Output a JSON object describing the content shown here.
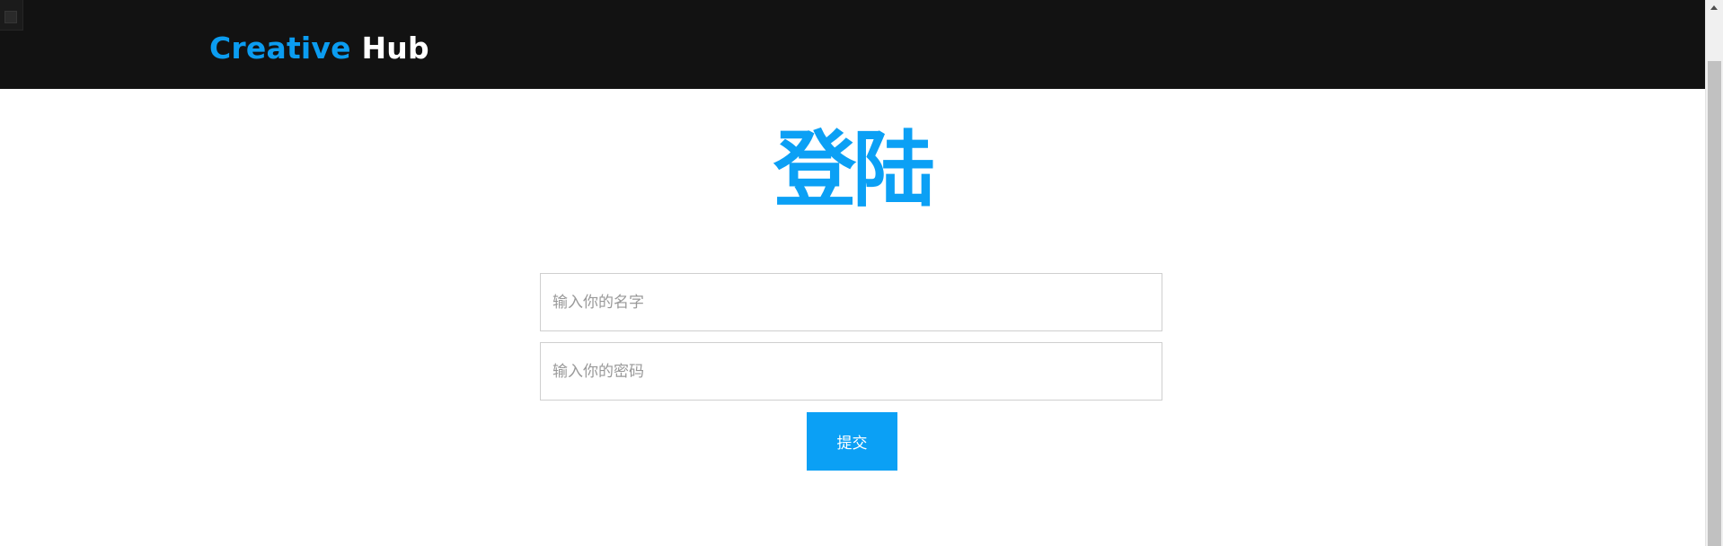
{
  "header": {
    "brand_primary": "Creative",
    "brand_secondary": "Hub",
    "background": "#121212",
    "brand_color": "#0b9cf0"
  },
  "main": {
    "heading": "登陆",
    "accent": "#0ba0f5",
    "form": {
      "name_placeholder": "输入你的名字",
      "name_value": "",
      "password_placeholder": "输入你的密码",
      "password_value": "",
      "submit_label": "提交"
    }
  },
  "icons": {
    "scroll_up": "scroll-up-arrow-icon"
  }
}
